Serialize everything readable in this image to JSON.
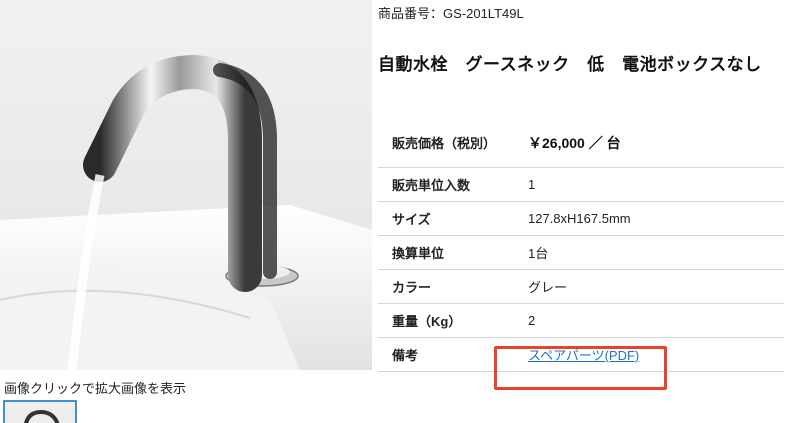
{
  "product": {
    "number": "商品番号：GS-201LT49L",
    "name": "自動水栓　グースネック　低　電池ボックスなし"
  },
  "image": {
    "caption": "画像クリックで拡大画像を表示"
  },
  "specs": [
    {
      "label": "販売価格（税別）",
      "value": "￥26,000 ／ 台"
    },
    {
      "label": "販売単位入数",
      "value": "1"
    },
    {
      "label": "サイズ",
      "value": "127.8xH167.5mm"
    },
    {
      "label": "換算単位",
      "value": "1台"
    },
    {
      "label": "カラー",
      "value": "グレー"
    },
    {
      "label": "重量（Kg）",
      "value": "2"
    },
    {
      "label": "備考",
      "value": "スペアパーツ(PDF)"
    }
  ],
  "colors": {
    "link": "#1a73c9",
    "highlight": "#e8412c",
    "thumb_border": "#3f8fd2"
  },
  "icons": {
    "faucet": "faucet-illustration"
  }
}
